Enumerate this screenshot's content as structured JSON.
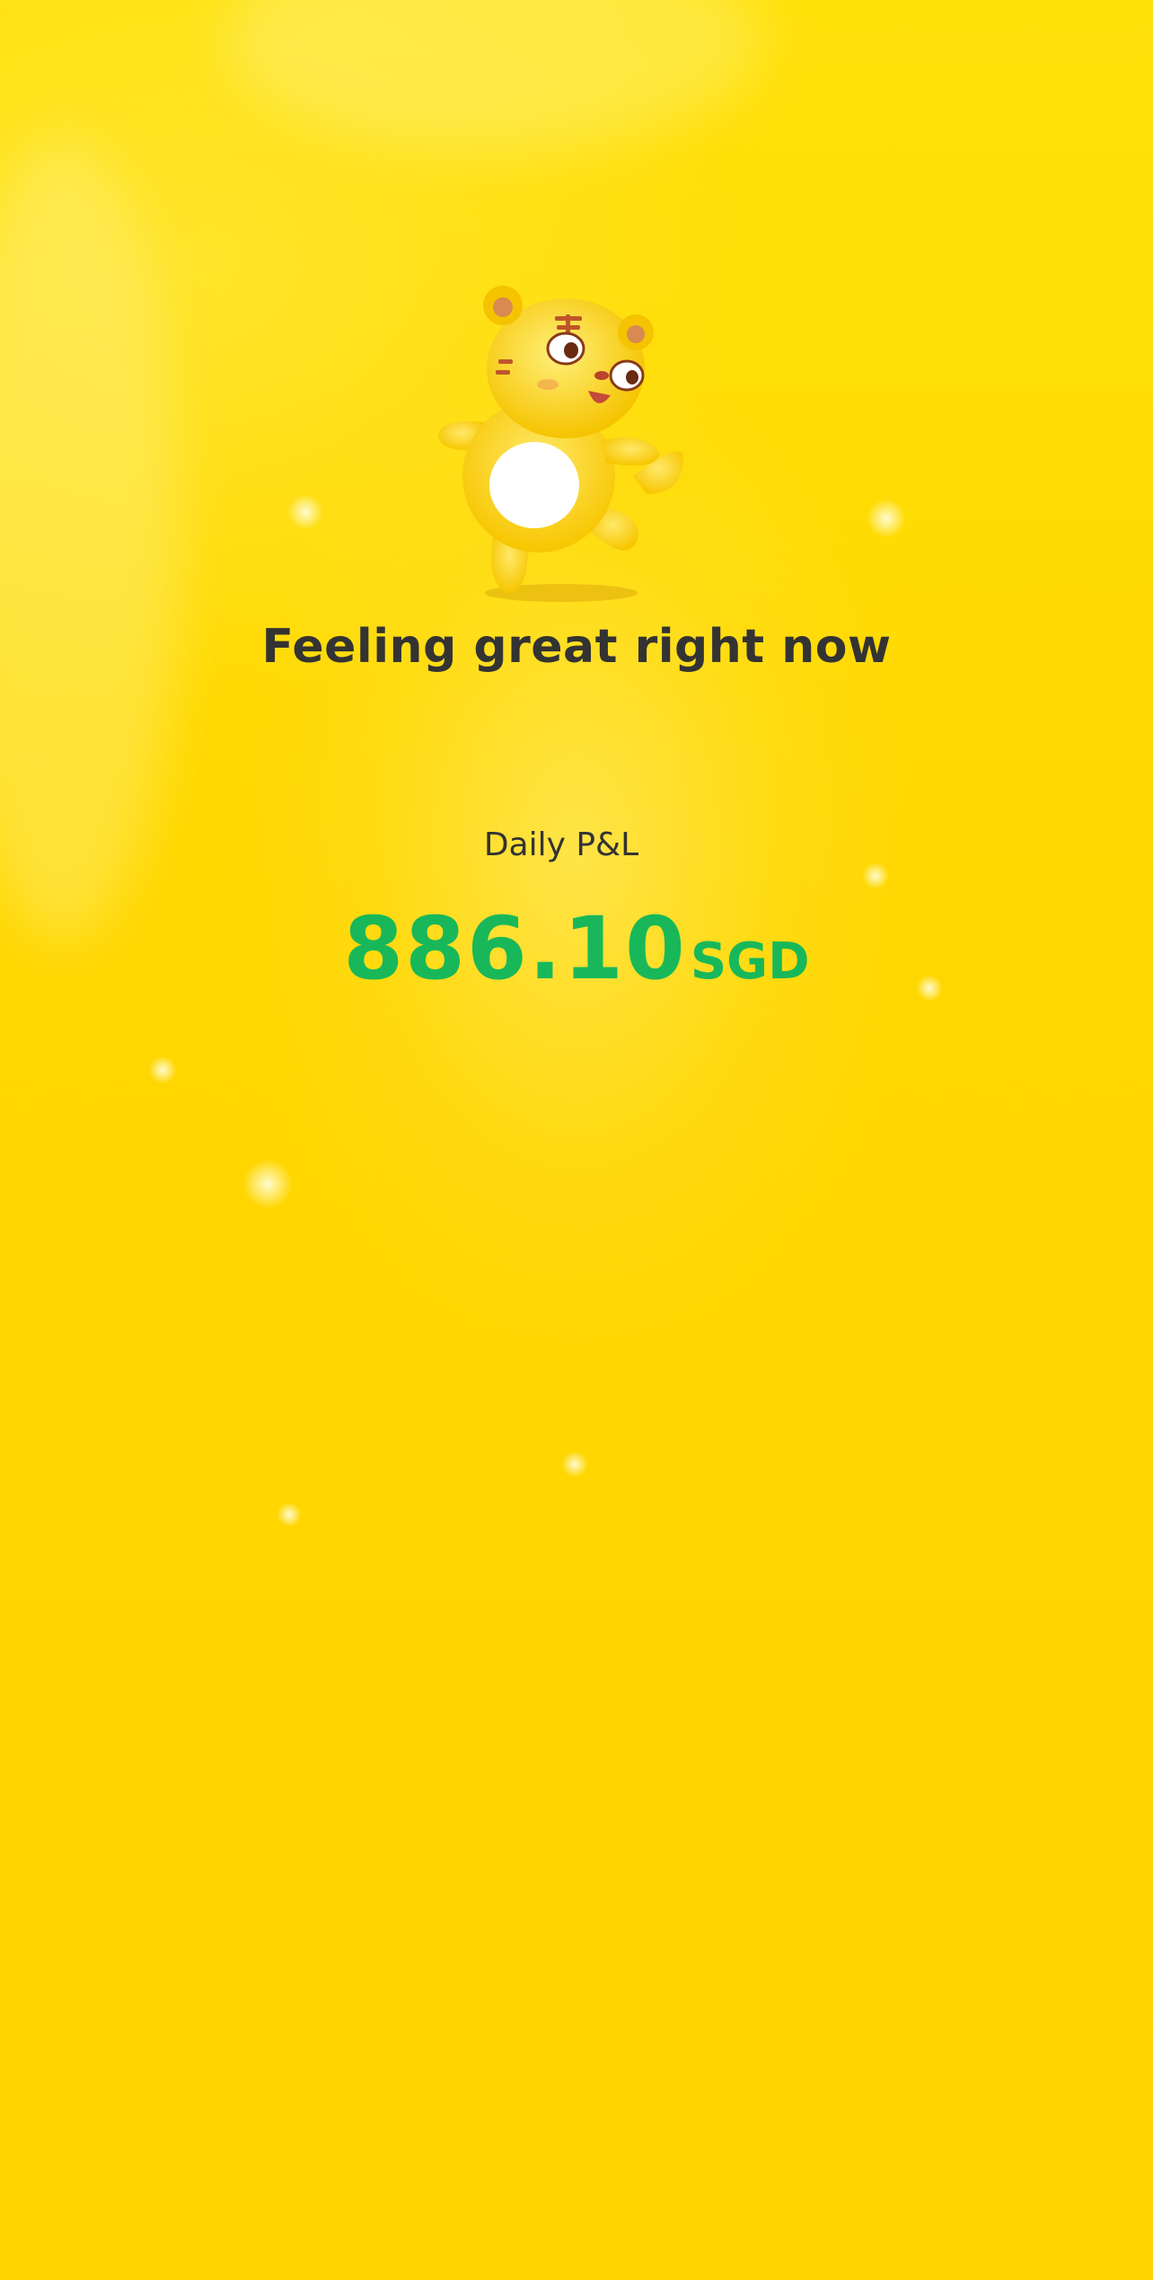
{
  "mood": {
    "message": "Feeling great right now",
    "mascot_icon": "tiger-mascot-icon"
  },
  "daily_pl": {
    "label": "Daily P&L",
    "amount": "886.10",
    "currency": "SGD"
  },
  "colors": {
    "background": "#ffd500",
    "text_primary": "#333333",
    "profit_green": "#18b85a"
  }
}
